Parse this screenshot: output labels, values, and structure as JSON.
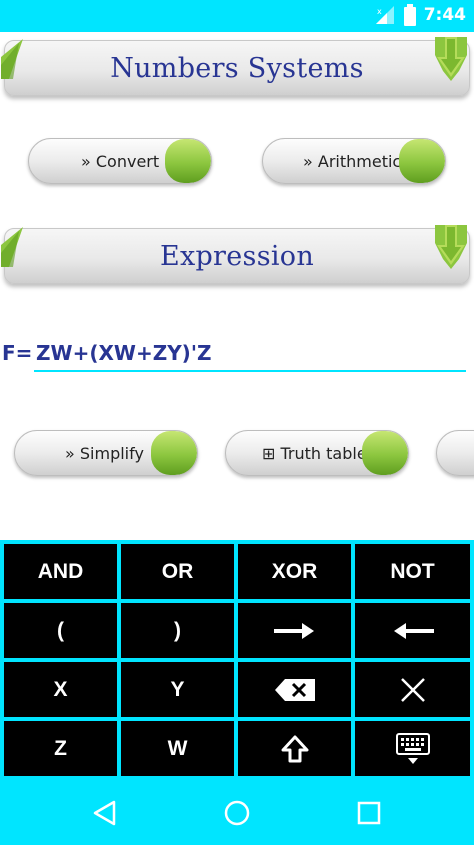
{
  "status_bar": {
    "time": "7:44",
    "icons": [
      "signal-icon",
      "battery-icon"
    ]
  },
  "sections": {
    "numbers": {
      "title": "Numbers Systems"
    },
    "expression": {
      "title": "Expression"
    }
  },
  "buttons": {
    "convert": "» Convert",
    "arithmetic": "» Arithmetic",
    "simplify": "» Simplify",
    "truth_table": "⊞ Truth table"
  },
  "expression": {
    "prefix": "F=",
    "value": "ZW+(XW+ZY)'Z"
  },
  "keypad": {
    "rows": [
      [
        "AND",
        "OR",
        "XOR",
        "NOT"
      ],
      [
        "(",
        ")",
        "→",
        "←"
      ],
      [
        "X",
        "Y",
        "backspace-icon",
        "clear-icon"
      ],
      [
        "Z",
        "W",
        "shift-icon",
        "keyboard-icon"
      ]
    ],
    "labels": {
      "and": "AND",
      "or": "OR",
      "xor": "XOR",
      "not": "NOT",
      "lparen": "(",
      "rparen": ")",
      "x": "X",
      "y": "Y",
      "z": "Z",
      "w": "W"
    }
  },
  "nav_bar": {
    "icons": [
      "back-icon",
      "home-icon",
      "recents-icon"
    ]
  },
  "colors": {
    "accent": "#00E5FF",
    "title_text": "#283593",
    "pill_green": "#8cc63f",
    "key_bg": "#000000"
  }
}
